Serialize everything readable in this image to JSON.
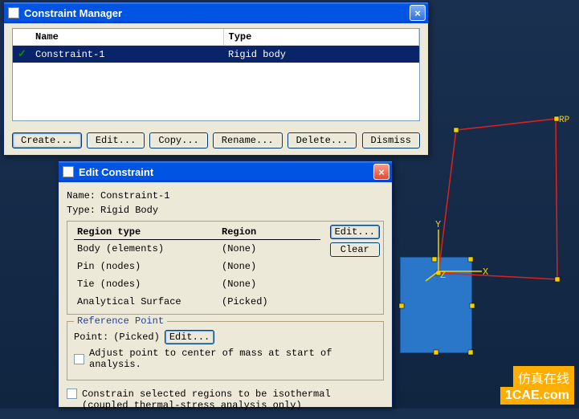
{
  "cm": {
    "title": "Constraint Manager",
    "columns": {
      "name": "Name",
      "type": "Type"
    },
    "rows": [
      {
        "check": "✓",
        "name": "Constraint-1",
        "type": "Rigid body"
      }
    ],
    "buttons": {
      "create": "Create...",
      "edit": "Edit...",
      "copy": "Copy...",
      "rename": "Rename...",
      "delete": "Delete...",
      "dismiss": "Dismiss"
    }
  },
  "ec": {
    "title": "Edit Constraint",
    "name_label": "Name:",
    "name_value": "Constraint-1",
    "type_label": "Type:",
    "type_value": "Rigid Body",
    "region_col1": "Region type",
    "region_col2": "Region",
    "region_rows": [
      {
        "label": "Body (elements)",
        "value": "(None)"
      },
      {
        "label": "Pin (nodes)",
        "value": "(None)"
      },
      {
        "label": "Tie (nodes)",
        "value": "(None)"
      },
      {
        "label": "Analytical Surface",
        "value": "(Picked)"
      }
    ],
    "edit_btn": "Edit...",
    "clear_btn": "Clear",
    "rp_legend": "Reference Point",
    "point_label": "Point:",
    "point_value": "(Picked)",
    "point_edit": "Edit...",
    "adjust_label": "Adjust point to center of mass at start of analysis.",
    "constrain_label1": "Constrain selected regions to be isothermal",
    "constrain_label2": "(coupled thermal-stress analysis only)"
  },
  "viewport": {
    "axes": {
      "x": "X",
      "y": "Y",
      "z": "Z"
    },
    "rp_label": "RP"
  },
  "watermark": {
    "cn": "仿真在线",
    "url": "1CAE.com",
    "bg": "1CAE . COM"
  }
}
